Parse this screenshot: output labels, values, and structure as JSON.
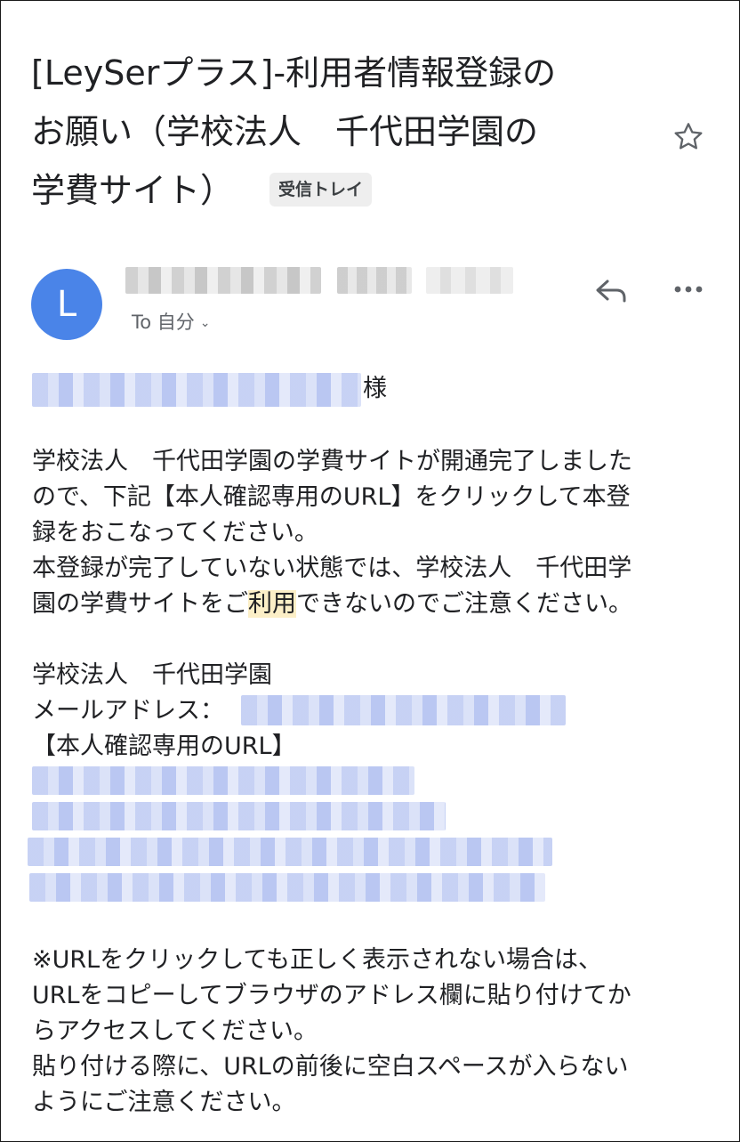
{
  "email": {
    "subject_lines": [
      "[LeySerプラス]-利用者情報登録の",
      "お願い（学校法人　千代田学園の",
      "学費サイト）"
    ],
    "label": "受信トレイ",
    "avatar_letter": "L",
    "to_line": "To 自分",
    "salutation_suffix": "様",
    "body": {
      "p1": [
        "学校法人　千代田学園の学費サイトが開通完了しました",
        "ので、下記【本人確認専用のURL】をクリックして本登",
        "録をおこなってください。",
        "本登録が完了していない状態では、学校法人　千代田学"
      ],
      "p1_last_before": "園の学費サイトをご",
      "p1_last_highlight": "利用",
      "p1_last_after": "できないのでご注意ください。",
      "org": "学校法人　千代田学園",
      "email_label": "メールアドレス：",
      "url_label": "【本人確認専用のURL】",
      "p2": [
        "※URLをクリックしても正しく表示されない場合は、",
        "URLをコピーしてブラウザのアドレス欄に貼り付けてか",
        "らアクセスしてください。",
        "貼り付ける際に、URLの前後に空白スペースが入らない",
        "ようにご注意ください。"
      ]
    }
  }
}
